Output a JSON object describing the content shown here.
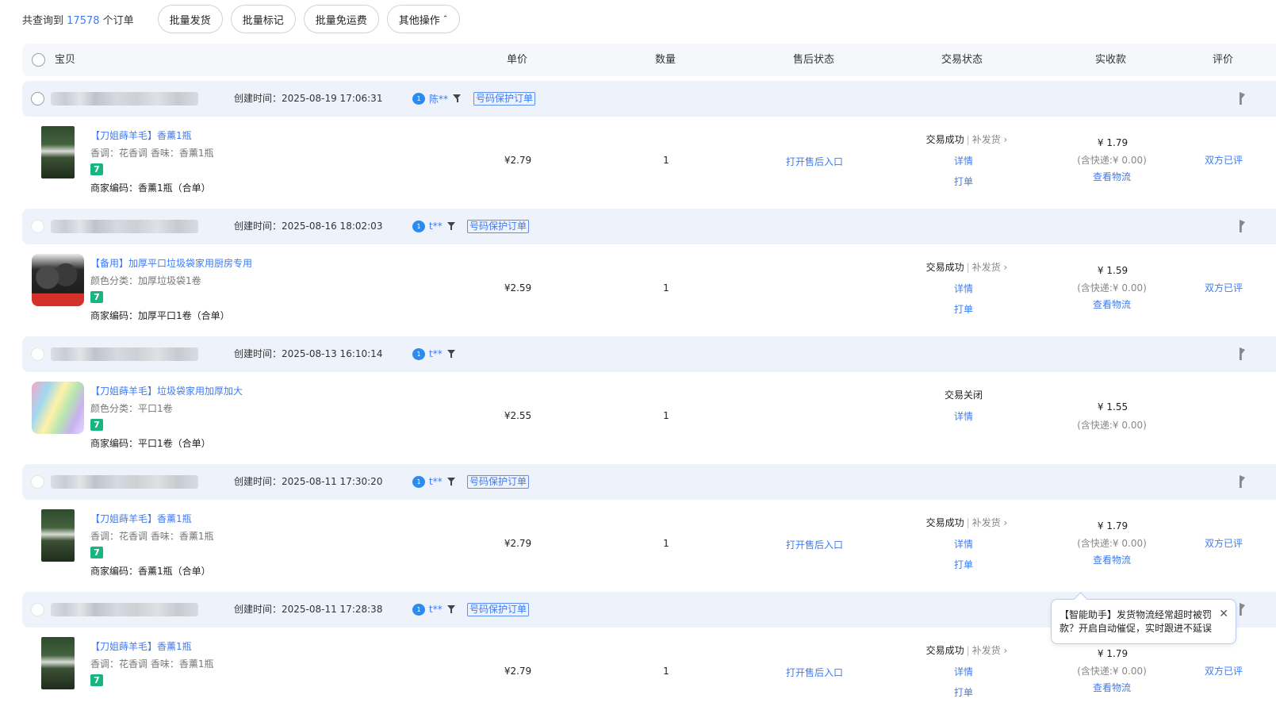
{
  "summary": {
    "prefix": "共查询到",
    "count": "17578",
    "suffix": "个订单"
  },
  "toolbar": {
    "batch_ship": "批量发货",
    "batch_mark": "批量标记",
    "batch_free_shipping": "批量免运费",
    "other_ops": "其他操作",
    "other_ops_chevron": "⌃"
  },
  "columns": {
    "item": "宝贝",
    "unit_price": "单价",
    "quantity": "数量",
    "after_sale": "售后状态",
    "trade_status": "交易状态",
    "received": "实收款",
    "review": "评价"
  },
  "orders": [
    {
      "created": "创建时间：2025-08-19 17:06:31",
      "buyer": "陈**",
      "tag": "号码保护订单",
      "title": "【刀姐蒔羊毛】香薰1瓶",
      "attr": "香调：花香调  香味：香薰1瓶",
      "badge": "7",
      "code": "商家编码：香薰1瓶（合单）",
      "price": "¥2.79",
      "qty": "1",
      "after_sale": "打开售后入口",
      "status": "交易成功",
      "reship": "补发货",
      "detail": "详情",
      "print": "打单",
      "paid": "¥ 1.79",
      "shipping": "(含快递:¥ 0.00)",
      "logistics": "查看物流",
      "review": "双方已评"
    },
    {
      "created": "创建时间：2025-08-16 18:02:03",
      "buyer": "t**",
      "tag": "号码保护订单",
      "title": "【备用】加厚平口垃圾袋家用厨房专用",
      "attr": "颜色分类：加厚垃圾袋1卷",
      "badge": "7",
      "code": "商家编码：加厚平口1卷（合单）",
      "price": "¥2.59",
      "qty": "1",
      "after_sale": "",
      "status": "交易成功",
      "reship": "补发货",
      "detail": "详情",
      "print": "打单",
      "paid": "¥ 1.59",
      "shipping": "(含快递:¥ 0.00)",
      "logistics": "查看物流",
      "review": "双方已评"
    },
    {
      "created": "创建时间：2025-08-13 16:10:14",
      "buyer": "t**",
      "tag": "",
      "title": "【刀姐蒔羊毛】垃圾袋家用加厚加大",
      "attr": "颜色分类：平口1卷",
      "badge": "7",
      "code": "商家编码：平口1卷（合单）",
      "price": "¥2.55",
      "qty": "1",
      "after_sale": "",
      "status": "交易关闭",
      "reship": "",
      "detail": "详情",
      "print": "",
      "paid": "¥ 1.55",
      "shipping": "(含快递:¥ 0.00)",
      "logistics": "",
      "review": ""
    },
    {
      "created": "创建时间：2025-08-11 17:30:20",
      "buyer": "t**",
      "tag": "号码保护订单",
      "title": "【刀姐蒔羊毛】香薰1瓶",
      "attr": "香调：花香调  香味：香薰1瓶",
      "badge": "7",
      "code": "商家编码：香薰1瓶（合单）",
      "price": "¥2.79",
      "qty": "1",
      "after_sale": "打开售后入口",
      "status": "交易成功",
      "reship": "补发货",
      "detail": "详情",
      "print": "打单",
      "paid": "¥ 1.79",
      "shipping": "(含快递:¥ 0.00)",
      "logistics": "查看物流",
      "review": "双方已评"
    },
    {
      "created": "创建时间：2025-08-11 17:28:38",
      "buyer": "t**",
      "tag": "号码保护订单",
      "title": "【刀姐蒔羊毛】香薰1瓶",
      "attr": "香调：花香调  香味：香薰1瓶",
      "badge": "7",
      "code": "",
      "price": "¥2.79",
      "qty": "1",
      "after_sale": "打开售后入口",
      "status": "交易成功",
      "reship": "补发货",
      "detail": "详情",
      "print": "打单",
      "paid": "¥ 1.79",
      "shipping": "(含快递:¥ 0.00)",
      "logistics": "查看物流",
      "review": "双方已评"
    }
  ],
  "assistant_tip": {
    "text": "【智能助手】发货物流经常超时被罚款？开启自动催促，实时跟进不延误",
    "close": "✕"
  },
  "icons": {
    "wangwang": "chat-bubble-icon",
    "filter": "filter-icon",
    "flag": "flag-icon",
    "chevron": "chevron-right-icon"
  },
  "colors": {
    "link": "#3d7bf5",
    "badge": "#19b57e",
    "row_header_bg": "#eef2fb"
  }
}
